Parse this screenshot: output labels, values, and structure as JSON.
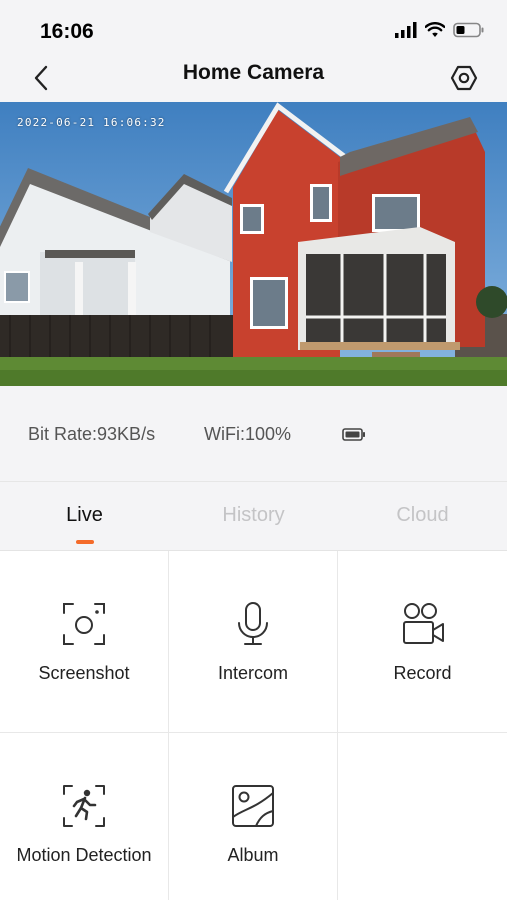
{
  "status_bar": {
    "time": "16:06"
  },
  "nav": {
    "title": "Home Camera",
    "back_icon": "chevron-left-icon",
    "settings_icon": "hexagon-gear-icon"
  },
  "video": {
    "timestamp": "2022-06-21  16:06:32"
  },
  "info": {
    "bit_rate": "Bit Rate:93KB/s",
    "wifi": "WiFi:100%"
  },
  "tabs": [
    {
      "label": "Live",
      "active": true
    },
    {
      "label": "History",
      "active": false
    },
    {
      "label": "Cloud",
      "active": false
    }
  ],
  "actions": [
    {
      "label": "Screenshot",
      "icon": "screenshot-icon"
    },
    {
      "label": "Intercom",
      "icon": "microphone-icon"
    },
    {
      "label": "Record",
      "icon": "video-camera-icon"
    },
    {
      "label": "Motion Detection",
      "icon": "motion-detection-icon"
    },
    {
      "label": "Album",
      "icon": "album-icon"
    }
  ],
  "colors": {
    "accent": "#f46b2a",
    "background": "#f4f4f6",
    "inactive_tab": "#c4c4c6"
  }
}
